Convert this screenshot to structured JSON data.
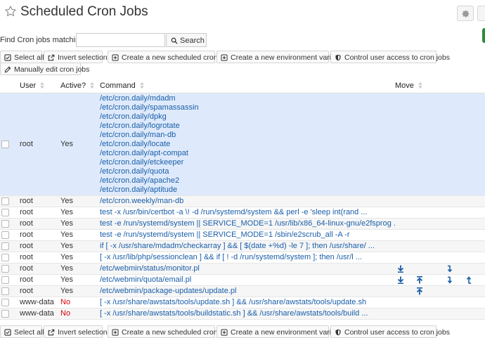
{
  "header": {
    "title": "Scheduled Cron Jobs"
  },
  "search": {
    "label": "Find Cron jobs matching",
    "value": "",
    "placeholder": "",
    "button_label": "Search"
  },
  "actions": {
    "select_all": "Select all",
    "invert_selection": "Invert selection",
    "create_job": "Create a new scheduled cron job",
    "create_env": "Create a new environment variable",
    "control_access": "Control user access to cron jobs",
    "manual_edit": "Manually edit cron jobs"
  },
  "columns": {
    "user": "User",
    "active": "Active?",
    "command": "Command",
    "move": "Move"
  },
  "rows": [
    {
      "user": "root",
      "active": "Yes",
      "highlight": true,
      "commands": [
        "/etc/cron.daily/mdadm",
        "/etc/cron.daily/spamassassin",
        "/etc/cron.daily/dpkg",
        "/etc/cron.daily/logrotate",
        "/etc/cron.daily/man-db",
        "/etc/cron.daily/locate",
        "/etc/cron.daily/apt-compat",
        "/etc/cron.daily/etckeeper",
        "/etc/cron.daily/quota",
        "/etc/cron.daily/apache2",
        "/etc/cron.daily/aptitude"
      ],
      "move": []
    },
    {
      "user": "root",
      "active": "Yes",
      "commands": [
        "/etc/cron.weekly/man-db"
      ],
      "move": []
    },
    {
      "user": "root",
      "active": "Yes",
      "commands": [
        "test -x /usr/bin/certbot -a \\! -d /run/systemd/system && perl -e 'sleep int(rand ..."
      ],
      "move": []
    },
    {
      "user": "root",
      "active": "Yes",
      "commands": [
        "test -e /run/systemd/system || SERVICE_MODE=1 /usr/lib/x86_64-linux-gnu/e2fsprog ..."
      ],
      "move": []
    },
    {
      "user": "root",
      "active": "Yes",
      "commands": [
        "test -e /run/systemd/system || SERVICE_MODE=1 /sbin/e2scrub_all -A -r"
      ],
      "move": []
    },
    {
      "user": "root",
      "active": "Yes",
      "commands": [
        "if [ -x /usr/share/mdadm/checkarray ] && [ $(date +%d) -le 7 ]; then /usr/share/ ..."
      ],
      "move": []
    },
    {
      "user": "root",
      "active": "Yes",
      "commands": [
        "[ -x /usr/lib/php/sessionclean ] && if [ ! -d /run/systemd/system ]; then /usr/l ..."
      ],
      "move": []
    },
    {
      "user": "root",
      "active": "Yes",
      "commands": [
        "/etc/webmin/status/monitor.pl"
      ],
      "move": [
        "down",
        "down-small"
      ]
    },
    {
      "user": "root",
      "active": "Yes",
      "commands": [
        "/etc/webmin/quota/email.pl"
      ],
      "move": [
        "down",
        "up",
        "down-small",
        "up-small"
      ]
    },
    {
      "user": "root",
      "active": "Yes",
      "commands": [
        "/etc/webmin/package-updates/update.pl"
      ],
      "move": [
        "up"
      ]
    },
    {
      "user": "www-data",
      "active": "No",
      "commands": [
        "[ -x /usr/share/awstats/tools/update.sh ] && /usr/share/awstats/tools/update.sh"
      ],
      "move": []
    },
    {
      "user": "www-data",
      "active": "No",
      "commands": [
        "[ -x /usr/share/awstats/tools/buildstatic.sh ] && /usr/share/awstats/tools/build ..."
      ],
      "move": []
    }
  ],
  "colors": {
    "accent": "#1a5ea8",
    "inactive": "#d9000d",
    "highlight_row": "#deeafb",
    "green": "#2e8b3a"
  }
}
